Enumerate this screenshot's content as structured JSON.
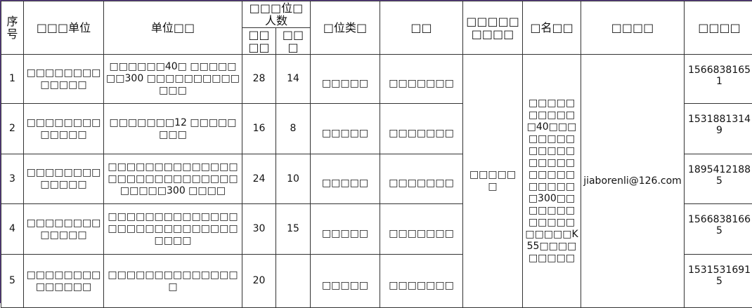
{
  "headers": {
    "seq": "序号",
    "unit_name": "□□□单位",
    "unit_desc": "单位□□",
    "positions_group": "□□□位□人数",
    "positions_a": "□□□□",
    "positions_b": "□□□",
    "category": "□位类□",
    "kind": "□□",
    "region": "□□□□□□□□□",
    "address": "□名□□",
    "email": "□□□□",
    "phone": "□□□□"
  },
  "rows": [
    {
      "seq": "1",
      "unit": "□□□□□□□□□□□□□",
      "desc": "□□□□□□40□ □□□□□□□300 □□□□□□□□□□□□□",
      "a": "28",
      "b": "14",
      "category": "□□□□□",
      "kind": "□□□□□□□",
      "phone": "15668381651"
    },
    {
      "seq": "2",
      "unit": "□□□□□□□□□□□□□",
      "desc": "□□□□□□□12 □□□□□□□□",
      "a": "16",
      "b": "8",
      "category": "□□□□□",
      "kind": "□□□□□□□",
      "phone": "15318813149"
    },
    {
      "seq": "3",
      "unit": "□□□□□□□□□□□□□",
      "desc": "□□□□□□□□□□□□□□□□□□□□□□□□□□□□□□□□□300 □□□□",
      "a": "24",
      "b": "10",
      "category": "□□□□□",
      "kind": "□□□□□□□",
      "phone": "18954121885"
    },
    {
      "seq": "4",
      "unit": "□□□□□□□□□□□□□",
      "desc": "□□□□□□□□□□□□□□□□□□□□□□□□□□□□□□□□",
      "a": "30",
      "b": "15",
      "category": "□□□□□",
      "kind": "□□□□□□□",
      "phone": "15668381665"
    },
    {
      "seq": "5",
      "unit": "□□□□□□□□□□□□□□",
      "desc": "□□□□□□□□□□□□□□□",
      "a": "20",
      "b": "",
      "category": "□□□□□",
      "kind": "□□□□□□□",
      "phone": "15315316915"
    }
  ],
  "merged": {
    "region": "□□□□□□",
    "address": "□□□□□□□□□□□40□□□□□□□□□□□□□□□□□□□□□□□□□□□□□300□□□□□□□□□□□□□□□□□K55□□□□□□□□□",
    "email": "jiaborenli@126.com"
  }
}
